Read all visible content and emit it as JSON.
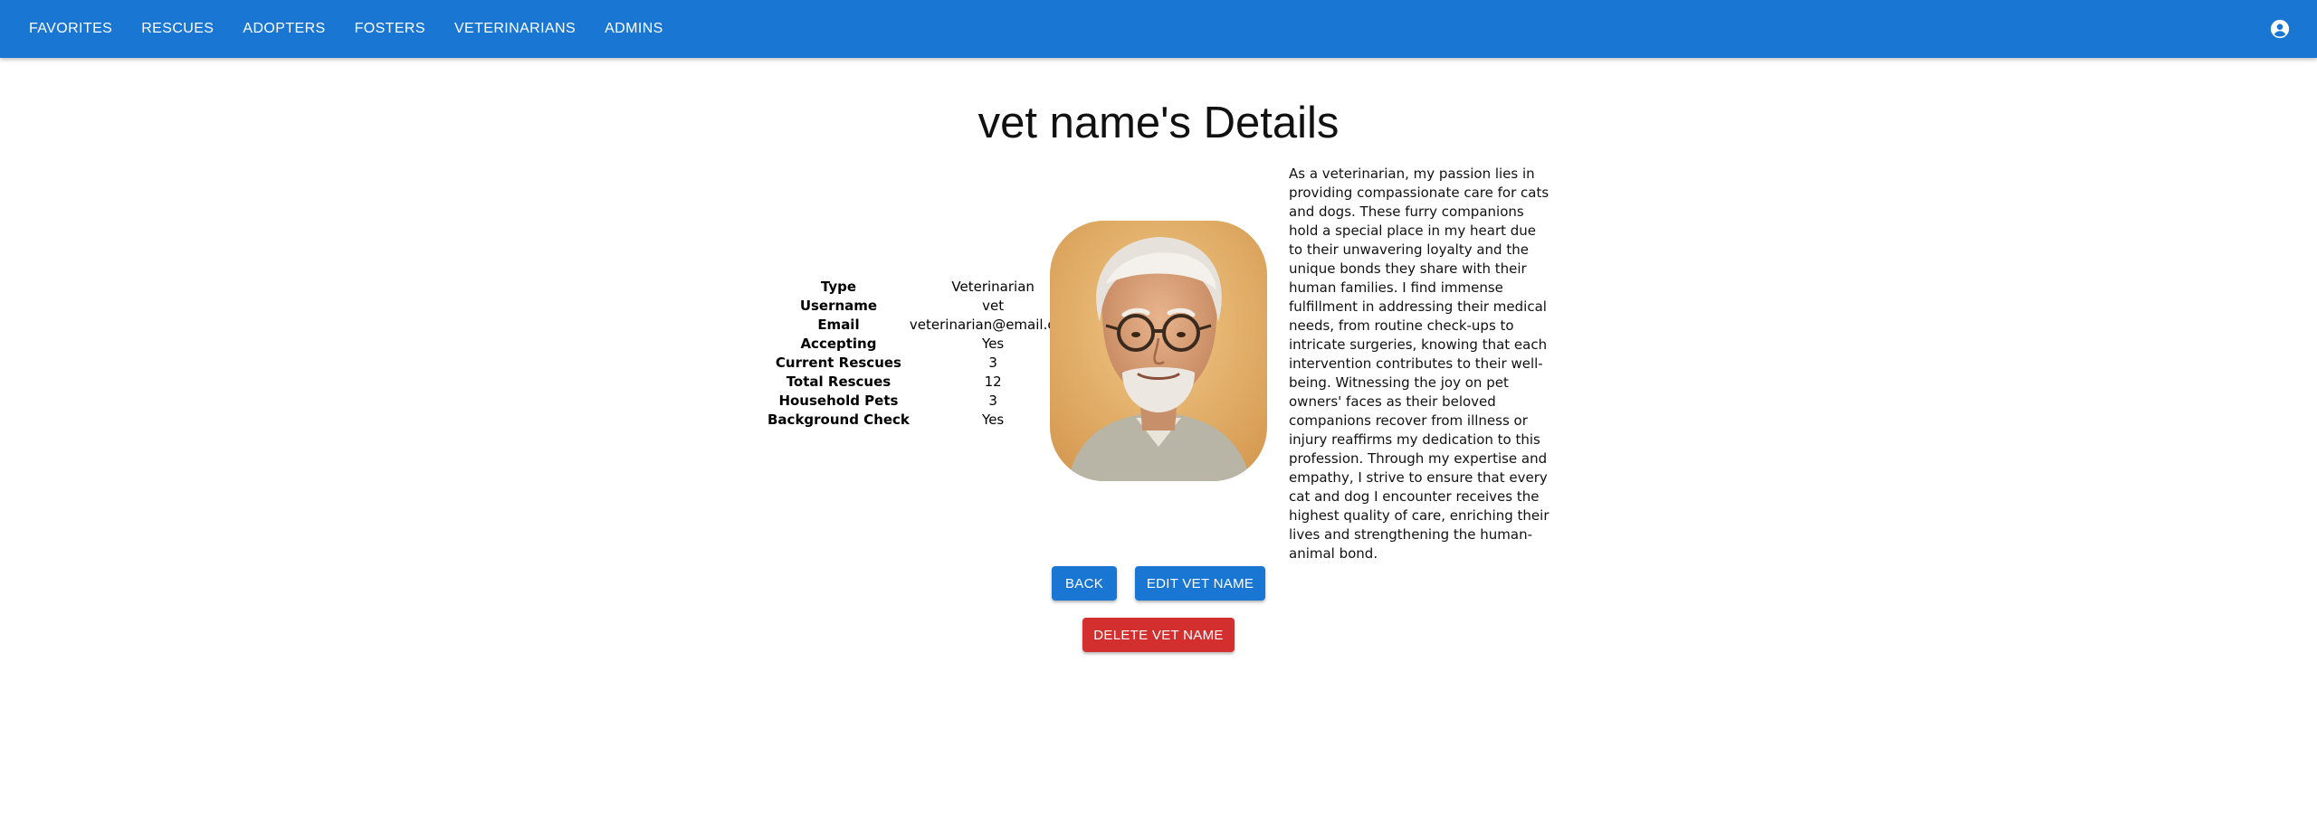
{
  "nav": {
    "items": [
      "FAVORITES",
      "RESCUES",
      "ADOPTERS",
      "FOSTERS",
      "VETERINARIANS",
      "ADMINS"
    ],
    "account_icon": "account-circle-icon"
  },
  "page": {
    "title": "vet name's Details"
  },
  "details": [
    {
      "label": "Type",
      "value": "Veterinarian"
    },
    {
      "label": "Username",
      "value": "vet"
    },
    {
      "label": "Email",
      "value": "veterinarian@email.com"
    },
    {
      "label": "Accepting",
      "value": "Yes"
    },
    {
      "label": "Current Rescues",
      "value": "3"
    },
    {
      "label": "Total Rescues",
      "value": "12"
    },
    {
      "label": "Household Pets",
      "value": "3"
    },
    {
      "label": "Background Check",
      "value": "Yes"
    }
  ],
  "bio": "As a veterinarian, my passion lies in providing compassionate care for cats and dogs. These furry companions hold a special place in my heart due to their unwavering loyalty and the unique bonds they share with their human families. I find immense fulfillment in addressing their medical needs, from routine check-ups to intricate surgeries, knowing that each intervention contributes to their well-being. Witnessing the joy on pet owners' faces as their beloved companions recover from illness or injury reaffirms my dedication to this profession. Through my expertise and empathy, I strive to ensure that every cat and dog I encounter receives the highest quality of care, enriching their lives and strengthening the human-animal bond.",
  "buttons": {
    "back": "BACK",
    "edit": "EDIT VET NAME",
    "delete": "DELETE VET NAME"
  },
  "colors": {
    "primary": "#1976d2",
    "danger": "#d32f2f"
  }
}
